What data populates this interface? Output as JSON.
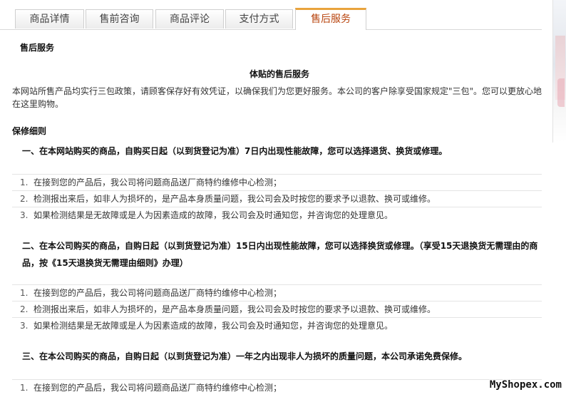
{
  "tabs": [
    {
      "label": "商品详情",
      "active": false
    },
    {
      "label": "售前咨询",
      "active": false
    },
    {
      "label": "商品评论",
      "active": false
    },
    {
      "label": "支付方式",
      "active": false
    },
    {
      "label": "售后服务",
      "active": true
    }
  ],
  "section_title": "售后服务",
  "intro": {
    "heading": "体贴的售后服务",
    "text": "本网站所售产品均实行三包政策，请顾客保存好有效凭证，以确保我们为您更好服务。本公司的客户除享受国家规定\"三包\"。您可以更放心地在这里购物。"
  },
  "repair": {
    "heading": "保修细则",
    "clauses": [
      {
        "title": "一、在本网站购买的商品，自购买日起（以到货登记为准）7日内出现性能故障，您可以选择退货、换货或修理。",
        "items": [
          {
            "num": "1.",
            "text": "在接到您的产品后，我公司将问题商品送厂商特约维修中心检测；"
          },
          {
            "num": "2.",
            "text": "检测报出来后，如非人为损坏的，是产品本身质量问题，我公司会及时按您的要求予以退款、换可或维修。"
          },
          {
            "num": "3.",
            "text": "如果检测结果是无故障或是人为因素造成的故障，我公司会及时通知您，并咨询您的处理意见。"
          }
        ]
      },
      {
        "title": "二、在本公司购买的商品，自购日起（以到货登记为准）15日内出现性能故障，您可以选择换货或修理。（享受15天退换货无需理由的商品，按《15天退换货无需理由细则》办理）",
        "items": [
          {
            "num": "1.",
            "text": "在接到您的产品后，我公司将问题商品送厂商特约维修中心检测；"
          },
          {
            "num": "2.",
            "text": "检测报出来后，如非人为损坏的，是产品本身质量问题，我公司会及时按您的要求予以退款、换可或维修。"
          },
          {
            "num": "3.",
            "text": "如果检测结果是无故障或是人为因素造成的故障，我公司会及时通知您，并咨询您的处理意见。"
          }
        ]
      },
      {
        "title": "三、在本公司购买的商品，自购日起（以到货登记为准）一年之内出现非人为损坏的质量问题，本公司承诺免费保修。",
        "items": [
          {
            "num": "1.",
            "text": "在接到您的产品后，我公司将问题商品送厂商特约维修中心检测；"
          }
        ]
      }
    ]
  },
  "watermark": "MyShopex.com",
  "colors": {
    "active_tab_text": "#b8440e",
    "active_tab_accent": "#e9a33c"
  }
}
